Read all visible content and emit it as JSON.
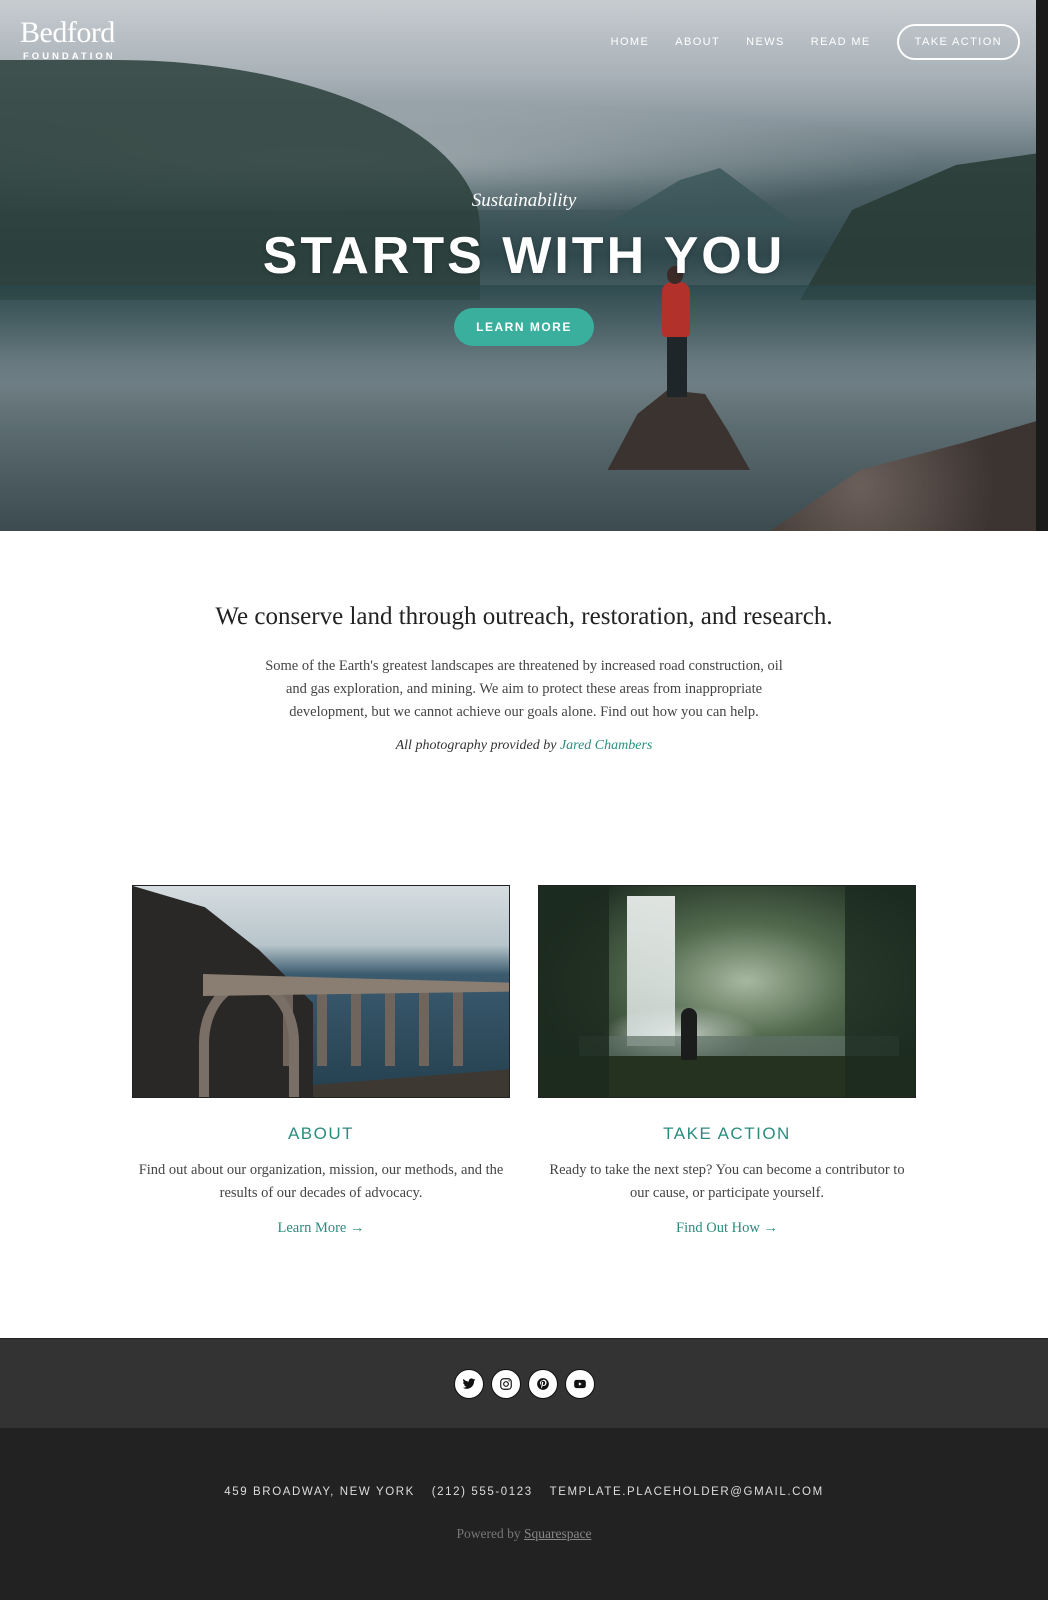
{
  "header": {
    "logo_main": "Bedford",
    "logo_sub": "FOUNDATION",
    "nav": [
      "HOME",
      "ABOUT",
      "NEWS",
      "READ ME"
    ],
    "cta": "TAKE ACTION"
  },
  "hero": {
    "kicker": "Sustainability",
    "heading": "STARTS WITH YOU",
    "button": "LEARN MORE"
  },
  "intro": {
    "headline": "We conserve land through outreach, restoration, and research.",
    "body": "Some of the Earth's greatest landscapes are threatened by increased road construction, oil and gas exploration, and mining. We aim to protect these areas from inappropriate development, but we cannot achieve our goals alone. Find out how you can help.",
    "credit_prefix": "All photography provided by",
    "credit_name": "Jared Chambers"
  },
  "cards": [
    {
      "title": "ABOUT",
      "text": "Find out about our organization, mission, our methods, and the results of our decades of advocacy.",
      "link": "Learn More →"
    },
    {
      "title": "TAKE ACTION",
      "text": "Ready to take the next step? You can become a contributor to our cause, or participate yourself.",
      "link": "Find Out How →"
    }
  ],
  "social": [
    "twitter-icon",
    "instagram-icon",
    "pinterest-icon",
    "youtube-icon"
  ],
  "footer": {
    "address": "459 BROADWAY, NEW YORK",
    "phone": "(212) 555-0123",
    "email": "TEMPLATE.PLACEHOLDER@GMAIL.COM",
    "powered_prefix": "Powered by",
    "powered_link": "Squarespace"
  },
  "colors": {
    "accent": "#3aaf9e",
    "accent_text": "#2b8c7e",
    "social_bar": "#333333",
    "footer_bg": "#222222"
  }
}
